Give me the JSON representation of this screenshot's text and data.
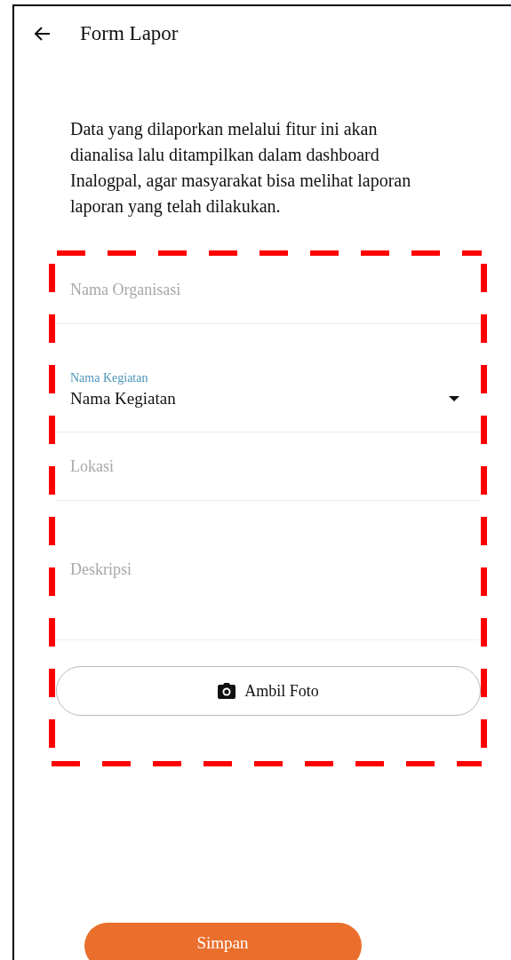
{
  "header": {
    "title": "Form Lapor"
  },
  "description": "Data yang dilaporkan melalui fitur ini akan\ndianalisa lalu ditampilkan dalam dashboard\nInalogpal, agar masyarakat bisa melihat laporan\nlaporan yang telah dilakukan.",
  "fields": [
    {
      "kind": "text",
      "placeholder": "Nama Organisasi"
    },
    {
      "kind": "dropdown",
      "label": "Nama Kegiatan",
      "value": "Nama Kegiatan"
    },
    {
      "kind": "text",
      "placeholder": "Lokasi"
    },
    {
      "kind": "textarea",
      "placeholder": "Deskripsi"
    }
  ],
  "photo_button": {
    "label": "Ambil Foto"
  },
  "submit_button": {
    "label": "Simpan"
  }
}
